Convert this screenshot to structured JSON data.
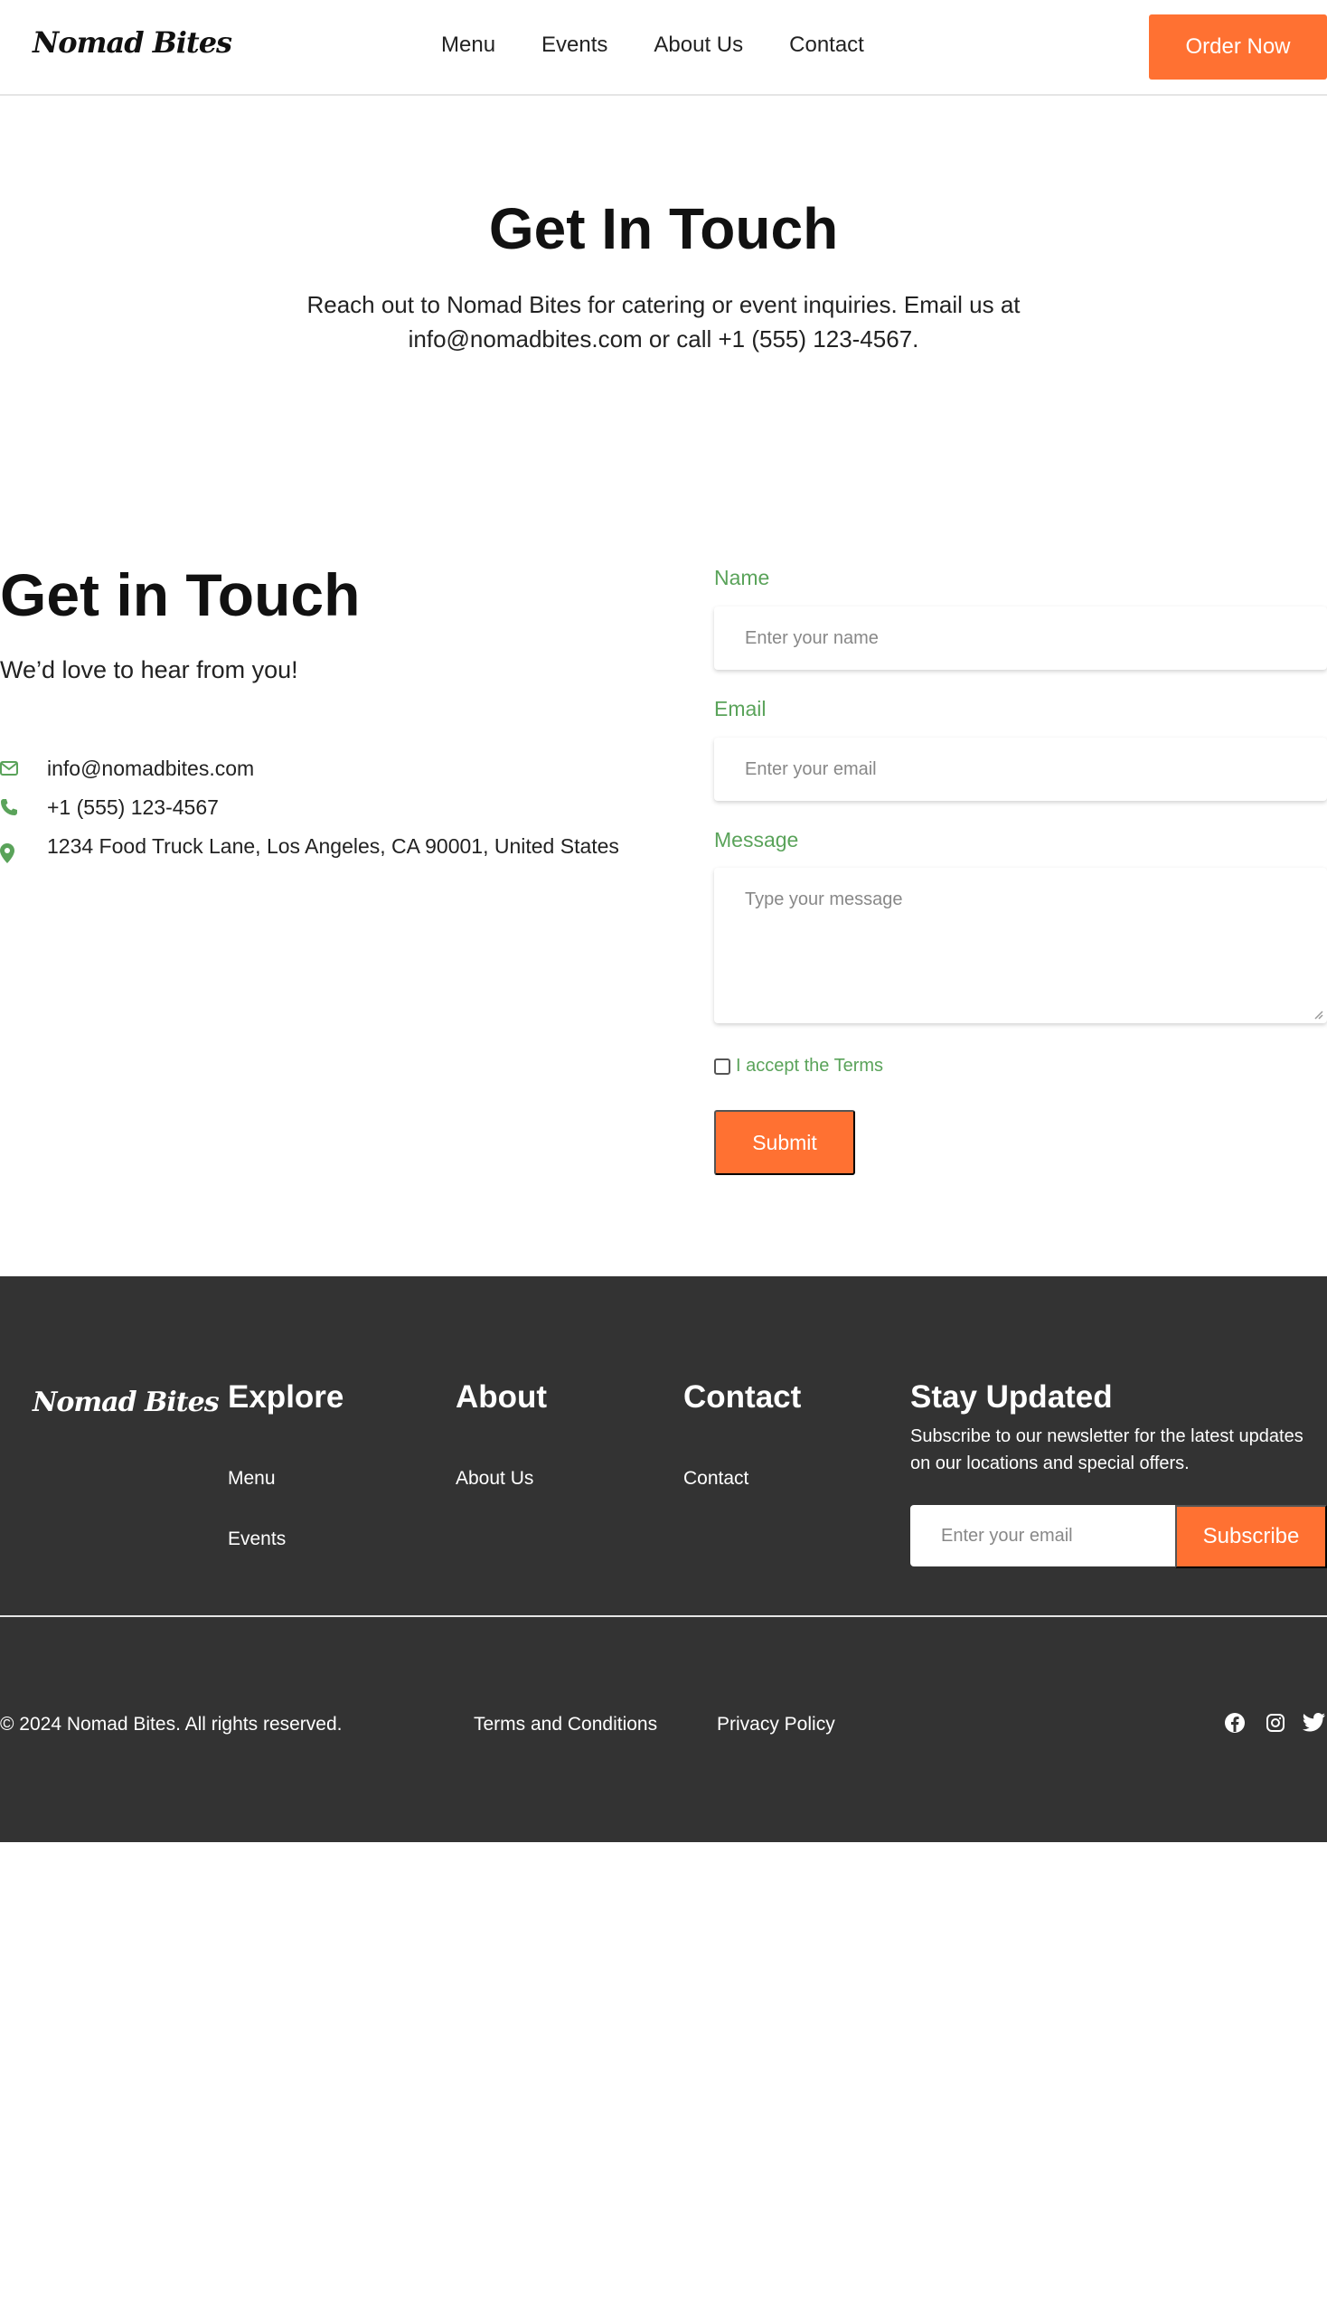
{
  "brand": {
    "name": "Nomad Bites",
    "accent": "#ff7132",
    "green": "#5aa35a",
    "footer_bg": "#333333"
  },
  "nav": {
    "links": [
      "Menu",
      "Events",
      "About Us",
      "Contact"
    ],
    "cta": "Order Now"
  },
  "hero": {
    "title": "Get In Touch",
    "subtitle": "Reach out to Nomad Bites for catering or event inquiries. Email us at info@nomadbites.com or call +1 (555) 123-4567."
  },
  "contact": {
    "title": "Get in Touch",
    "subtitle": "We’d love to hear from you!",
    "items": [
      {
        "icon": "envelope-icon",
        "text": "info@nomadbites.com"
      },
      {
        "icon": "phone-icon",
        "text": "+1 (555) 123-4567"
      },
      {
        "icon": "map-pin-icon",
        "text": "1234 Food Truck Lane, Los Angeles, CA 90001, United States"
      }
    ]
  },
  "form": {
    "name_label": "Name",
    "name_placeholder": "Enter your name",
    "email_label": "Email",
    "email_placeholder": "Enter your email",
    "message_label": "Message",
    "message_placeholder": "Type your message",
    "terms_label": "I accept the Terms",
    "submit_label": "Submit"
  },
  "footer": {
    "logo": "Nomad Bites",
    "explore_title": "Explore",
    "explore_links": [
      "Menu",
      "Events"
    ],
    "about_title": "About",
    "about_links": [
      "About Us"
    ],
    "contact_title": "Contact",
    "contact_links": [
      "Contact"
    ],
    "newsletter_title": "Stay Updated",
    "newsletter_text": "Subscribe to our newsletter for the latest updates on our locations and special offers.",
    "newsletter_placeholder": "Enter your email",
    "subscribe_label": "Subscribe",
    "copyright": "© 2024 Nomad Bites. All rights reserved.",
    "legal_links": [
      "Terms and Conditions",
      "Privacy Policy"
    ],
    "social": [
      "facebook-icon",
      "instagram-icon",
      "twitter-icon"
    ]
  }
}
